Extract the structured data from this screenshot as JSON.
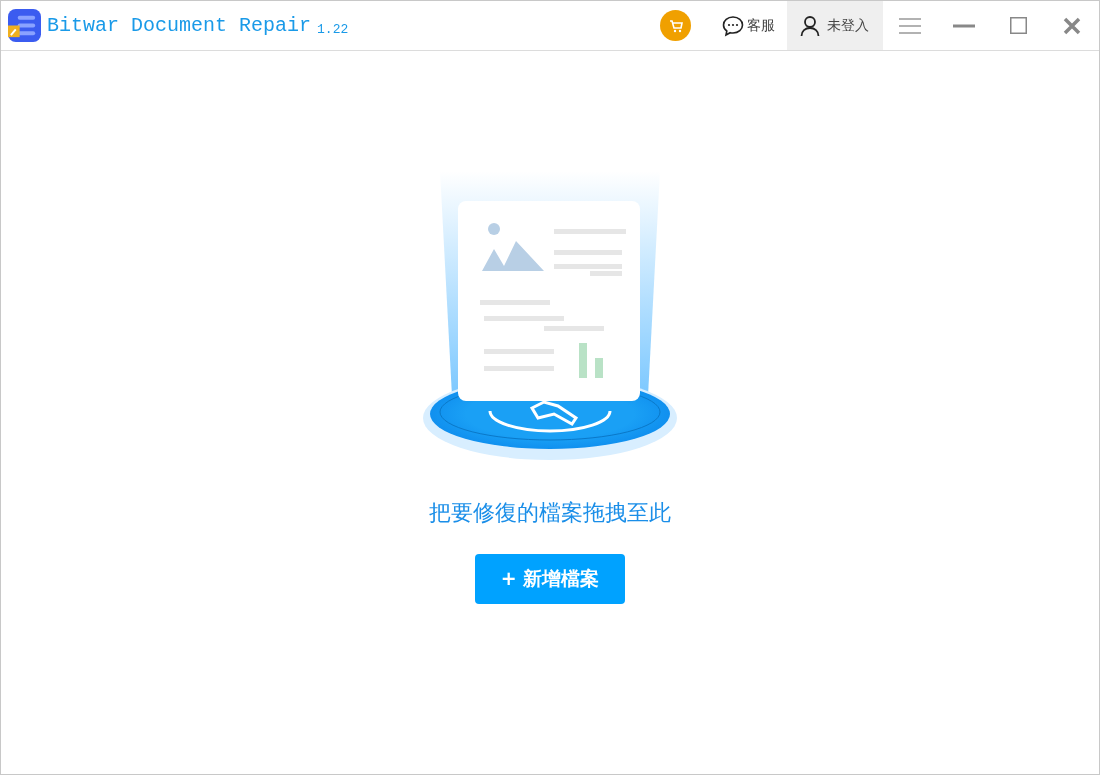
{
  "window": {
    "title": "Bitwar Document Repair",
    "version": "1.22"
  },
  "toolbar": {
    "support": "客服",
    "account": "未登入"
  },
  "dropzone": {
    "hint": "把要修復的檔案拖拽至此",
    "button": "+ 新增檔案"
  }
}
